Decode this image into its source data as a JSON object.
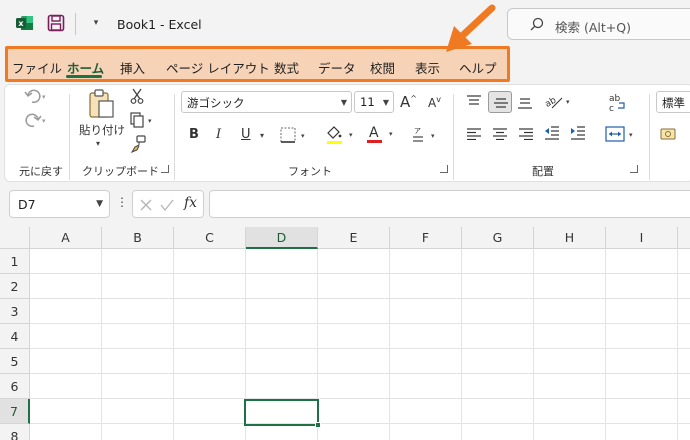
{
  "window": {
    "app_name": "Excel",
    "document": "Book1",
    "title": "Book1  -  Excel",
    "search_placeholder": "検索 (Alt+Q)",
    "qat_more": "▾"
  },
  "tabs": [
    {
      "label": "ファイル",
      "active": false
    },
    {
      "label": "ホーム",
      "active": true
    },
    {
      "label": "挿入",
      "active": false
    },
    {
      "label": "ページ レイアウト",
      "active": false
    },
    {
      "label": "数式",
      "active": false
    },
    {
      "label": "データ",
      "active": false
    },
    {
      "label": "校閲",
      "active": false
    },
    {
      "label": "表示",
      "active": false
    },
    {
      "label": "ヘルプ",
      "active": false
    }
  ],
  "ribbon": {
    "groups": {
      "undo": "元に戻す",
      "clipboard": "クリップボード",
      "font": "フォント",
      "alignment": "配置"
    },
    "paste_label": "貼り付け",
    "font_name": "游ゴシック",
    "font_size": "11",
    "number_format": "標準",
    "bold": "B",
    "italic": "I",
    "underline": "U",
    "grow_font": "A",
    "shrink_font": "A",
    "font_color_letter": "A",
    "phonetic": "ア",
    "wrap_label": "ab",
    "wrap_sub": "c"
  },
  "formula_bar": {
    "name_box": "D7",
    "fx": "fx",
    "formula": ""
  },
  "grid": {
    "columns": [
      "A",
      "B",
      "C",
      "D",
      "E",
      "F",
      "G",
      "H",
      "I"
    ],
    "rows": [
      "1",
      "2",
      "3",
      "4",
      "5",
      "6",
      "7",
      "8"
    ],
    "active_column": "D",
    "active_row": "7"
  },
  "colors": {
    "excel_green": "#1e7145",
    "highlight_orange": "#f07a21",
    "highlight_fill": "#f6d2b7"
  }
}
